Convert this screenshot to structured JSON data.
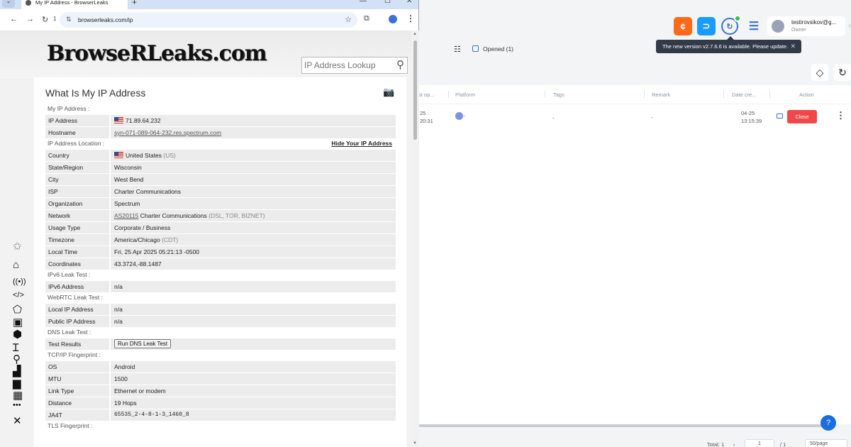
{
  "app": {
    "icons": [
      "coin-icon",
      "support-icon",
      "sync-icon",
      "task-list-icon"
    ],
    "user": {
      "name": "testirovsikov@g...",
      "role": "Owner"
    },
    "update_tooltip": "The new version v2.7.6.6 is available. Please update.",
    "filter": {
      "opened_label": "Opened (1)"
    },
    "table": {
      "headers": [
        "st op...",
        "Platform",
        "Tags",
        "Remark",
        "Date cre...",
        "Action"
      ],
      "row": {
        "last_open_date": "25",
        "last_open_time": "20:31",
        "platform": "-",
        "tags": "-",
        "remark": "-",
        "date_created": "04-25",
        "time_created": "13:15:39",
        "action_label": "Close"
      }
    },
    "pager": {
      "total": "Total: 1",
      "page": "1",
      "of": "/ 1",
      "per_page": "50/page"
    }
  },
  "browser": {
    "tab_title": "My IP Address - BrowserLeaks",
    "url": "browserleaks.com/ip",
    "reload_count": "1",
    "site": {
      "logo_text": "BrowseRLeaks.com",
      "search_placeholder": "IP Address Lookup",
      "page_title": "What Is My IP Address",
      "hide_ip_link": "Hide Your IP Address",
      "sections": [
        {
          "heading": "My IP Address :",
          "rows": [
            {
              "k": "IP Address",
              "v": "71.89.64.232",
              "flag": true
            },
            {
              "k": "Hostname",
              "v": "syn-071-089-064-232.res.spectrum.com",
              "link": true
            }
          ]
        },
        {
          "heading": "IP Address Location :",
          "rows": [
            {
              "k": "Country",
              "v": "United States",
              "extra": "(US)",
              "flag": true
            },
            {
              "k": "State/Region",
              "v": "Wisconsin"
            },
            {
              "k": "City",
              "v": "West Bend"
            },
            {
              "k": "ISP",
              "v": "Charter Communications"
            },
            {
              "k": "Organization",
              "v": "Spectrum"
            },
            {
              "k": "Network",
              "asn": "AS20115",
              "v": "Charter Communications",
              "extra": "(DSL, TOR, BIZNET)"
            },
            {
              "k": "Usage Type",
              "v": "Corporate / Business"
            },
            {
              "k": "Timezone",
              "v": "America/Chicago",
              "extra": "(CDT)"
            },
            {
              "k": "Local Time",
              "v": "Fri, 25 Apr 2025 05:21:13 -0500"
            },
            {
              "k": "Coordinates",
              "v": "43.3724,-88.1487"
            }
          ]
        },
        {
          "heading": "IPv6 Leak Test :",
          "rows": [
            {
              "k": "IPv6 Address",
              "v": "n/a"
            }
          ]
        },
        {
          "heading": "WebRTC Leak Test :",
          "rows": [
            {
              "k": "Local IP Address",
              "v": "n/a"
            },
            {
              "k": "Public IP Address",
              "v": "n/a"
            }
          ]
        },
        {
          "heading": "DNS Leak Test :",
          "rows": [
            {
              "k": "Test Results",
              "button": "Run DNS Leak Test"
            }
          ]
        },
        {
          "heading": "TCP/IP Fingerprint :",
          "rows": [
            {
              "k": "OS",
              "v": "Android"
            },
            {
              "k": "MTU",
              "v": "1500"
            },
            {
              "k": "Link Type",
              "v": "Ethernet or modem"
            },
            {
              "k": "Distance",
              "v": "19 Hops"
            },
            {
              "k": "JA4T",
              "v": "65535_2-4-8-1-3_1460_8",
              "mono": true
            }
          ]
        },
        {
          "heading": "TLS Fingerprint :",
          "rows": []
        }
      ]
    }
  }
}
